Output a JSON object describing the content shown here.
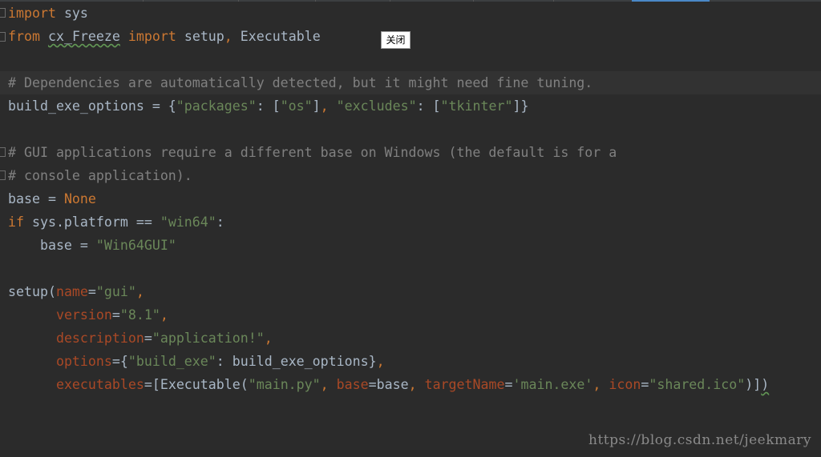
{
  "tooltip": {
    "close_label": "关闭"
  },
  "watermark": "https://blog.csdn.net/jeekmary",
  "colors": {
    "background": "#2b2b2b",
    "keyword": "#cc7832",
    "string": "#6a8759",
    "comment": "#808080",
    "parameter": "#aa4926",
    "default_text": "#a9b7c6"
  },
  "code": [
    [
      {
        "t": "import",
        "c": "kw"
      },
      {
        "t": " sys"
      }
    ],
    [
      {
        "t": "from",
        "c": "kw"
      },
      {
        "t": " "
      },
      {
        "t": "cx_Freeze",
        "c": "typo"
      },
      {
        "t": " "
      },
      {
        "t": "import",
        "c": "kw"
      },
      {
        "t": " setup"
      },
      {
        "t": ",",
        "c": "kw"
      },
      {
        "t": " Executable"
      }
    ],
    [],
    [
      {
        "t": "# Dependencies are automatically detected, but it might need fine tuning.",
        "c": "cmt"
      }
    ],
    [
      {
        "t": "build_exe_options = {"
      },
      {
        "t": "\"packages\"",
        "c": "str"
      },
      {
        "t": ": ["
      },
      {
        "t": "\"os\"",
        "c": "str"
      },
      {
        "t": "]"
      },
      {
        "t": ",",
        "c": "kw"
      },
      {
        "t": " "
      },
      {
        "t": "\"excludes\"",
        "c": "str"
      },
      {
        "t": ": ["
      },
      {
        "t": "\"tkinter\"",
        "c": "str"
      },
      {
        "t": "]}"
      }
    ],
    [],
    [
      {
        "t": "# GUI applications require a different base on Windows (the default is for a",
        "c": "cmt"
      }
    ],
    [
      {
        "t": "# console application).",
        "c": "cmt"
      }
    ],
    [
      {
        "t": "base = "
      },
      {
        "t": "None",
        "c": "kw"
      }
    ],
    [
      {
        "t": "if",
        "c": "kw"
      },
      {
        "t": " sys.platform == "
      },
      {
        "t": "\"win64\"",
        "c": "str"
      },
      {
        "t": ":"
      }
    ],
    [
      {
        "t": "    base = "
      },
      {
        "t": "\"Win64GUI\"",
        "c": "str"
      }
    ],
    [],
    [
      {
        "t": "setup("
      },
      {
        "t": "name",
        "c": "param"
      },
      {
        "t": "="
      },
      {
        "t": "\"gui\"",
        "c": "str"
      },
      {
        "t": ",",
        "c": "kw"
      }
    ],
    [
      {
        "t": "      "
      },
      {
        "t": "version",
        "c": "param"
      },
      {
        "t": "="
      },
      {
        "t": "\"8.1\"",
        "c": "str"
      },
      {
        "t": ",",
        "c": "kw"
      }
    ],
    [
      {
        "t": "      "
      },
      {
        "t": "description",
        "c": "param"
      },
      {
        "t": "="
      },
      {
        "t": "\"application!\"",
        "c": "str"
      },
      {
        "t": ",",
        "c": "kw"
      }
    ],
    [
      {
        "t": "      "
      },
      {
        "t": "options",
        "c": "param"
      },
      {
        "t": "={"
      },
      {
        "t": "\"build_exe\"",
        "c": "str"
      },
      {
        "t": ": build_exe_options}"
      },
      {
        "t": ",",
        "c": "kw"
      }
    ],
    [
      {
        "t": "      "
      },
      {
        "t": "executables",
        "c": "param"
      },
      {
        "t": "=[Executable("
      },
      {
        "t": "\"main.py\"",
        "c": "str"
      },
      {
        "t": ",",
        "c": "kw"
      },
      {
        "t": " "
      },
      {
        "t": "base",
        "c": "param"
      },
      {
        "t": "=base"
      },
      {
        "t": ",",
        "c": "kw"
      },
      {
        "t": " "
      },
      {
        "t": "targetName",
        "c": "param"
      },
      {
        "t": "="
      },
      {
        "t": "'main.exe'",
        "c": "str"
      },
      {
        "t": ",",
        "c": "kw"
      },
      {
        "t": " "
      },
      {
        "t": "icon",
        "c": "param"
      },
      {
        "t": "="
      },
      {
        "t": "\"shared.ico\"",
        "c": "str"
      },
      {
        "t": ")]"
      },
      {
        "t": ")",
        "c": "typo"
      }
    ]
  ]
}
